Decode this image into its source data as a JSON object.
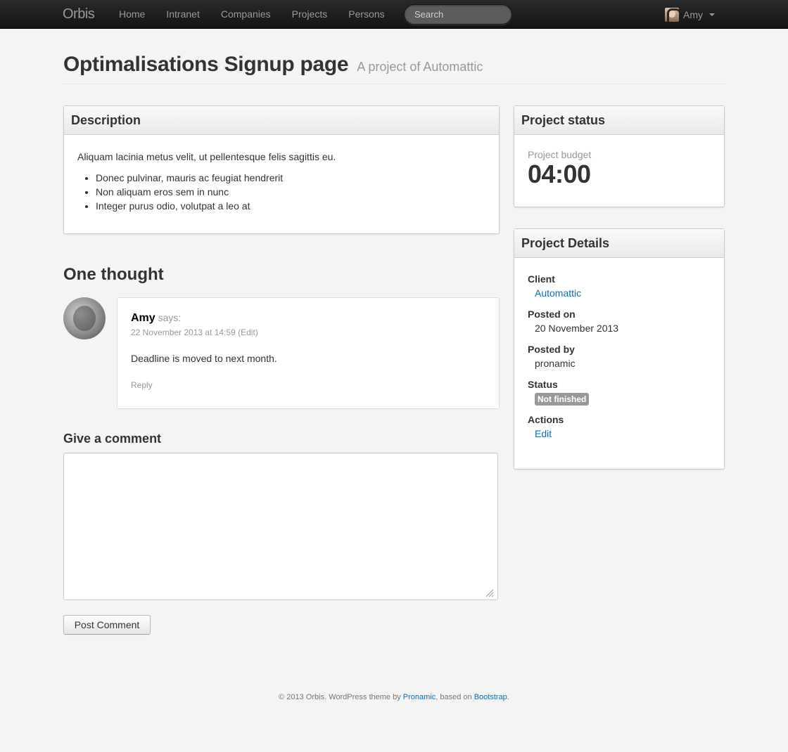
{
  "navbar": {
    "brand": "Orbis",
    "items": [
      "Home",
      "Intranet",
      "Companies",
      "Projects",
      "Persons"
    ],
    "search_placeholder": "Search",
    "user_name": "Amy"
  },
  "header": {
    "title": "Optimalisations Signup page",
    "subtitle": "A project of Automattic"
  },
  "description": {
    "heading": "Description",
    "text": "Aliquam lacinia metus velit, ut pellentesque felis sagittis eu.",
    "bullets": [
      "Donec pulvinar, mauris ac feugiat hendrerit",
      "Non aliquam eros sem in nunc",
      "Integer purus odio, volutpat a leo at"
    ]
  },
  "status_panel": {
    "heading": "Project status",
    "budget_label": "Project budget",
    "budget_value": "04:00"
  },
  "details_panel": {
    "heading": "Project Details",
    "client_label": "Client",
    "client_value": "Automattic",
    "posted_on_label": "Posted on",
    "posted_on_value": "20 November 2013",
    "posted_by_label": "Posted by",
    "posted_by_value": "pronamic",
    "status_label": "Status",
    "status_value": "Not finished",
    "actions_label": "Actions",
    "actions_value": "Edit"
  },
  "comments": {
    "title": "One thought",
    "items": [
      {
        "author": "Amy",
        "says": "says:",
        "date": "22 November 2013 at 14:59",
        "edit": "(Edit)",
        "text": "Deadline is moved to next month.",
        "reply": "Reply"
      }
    ]
  },
  "comment_form": {
    "title": "Give a comment",
    "textarea_value": "",
    "submit_label": "Post Comment"
  },
  "footer": {
    "copyright": "© 2013 Orbis. WordPress theme by",
    "pronamic": "Pronamic",
    "based_on": ", based on",
    "bootstrap": "Bootstrap",
    "end": "."
  }
}
